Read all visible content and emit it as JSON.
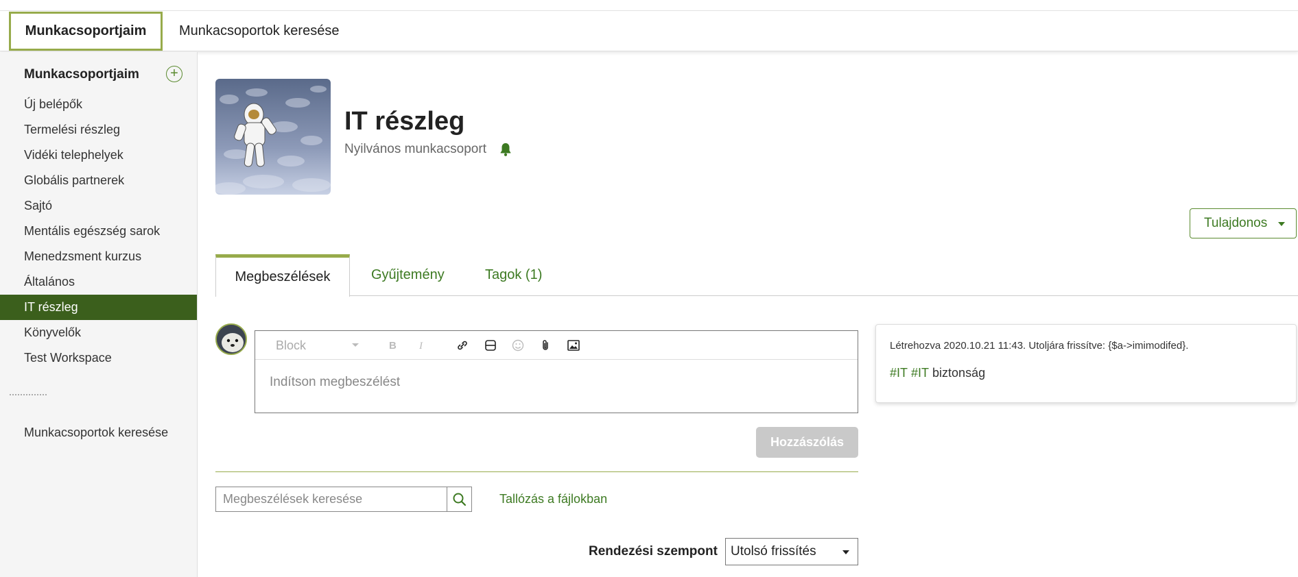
{
  "top_tabs": [
    {
      "label": "Munkacsoportjaim",
      "active": true
    },
    {
      "label": "Munkacsoportok keresése",
      "active": false
    }
  ],
  "sidebar": {
    "title": "Munkacsoportjaim",
    "add_label": "+",
    "items": [
      {
        "label": "Új belépők"
      },
      {
        "label": "Termelési részleg"
      },
      {
        "label": "Vidéki telephelyek"
      },
      {
        "label": "Globális partnerek"
      },
      {
        "label": "Sajtó"
      },
      {
        "label": "Mentális egészség sarok"
      },
      {
        "label": "Menedzsment kurzus"
      },
      {
        "label": "Általános"
      },
      {
        "label": "IT részleg",
        "active": true
      },
      {
        "label": "Könyvelők"
      },
      {
        "label": "Test Workspace"
      }
    ],
    "search_link": "Munkacsoportok keresése"
  },
  "workspace": {
    "title": "IT részleg",
    "subtitle": "Nyilvános munkacsoport",
    "role_button": "Tulajdonos"
  },
  "content_tabs": [
    {
      "label": "Megbeszélések",
      "active": true
    },
    {
      "label": "Gyűjtemény"
    },
    {
      "label": "Tagok (1)"
    }
  ],
  "editor": {
    "block_label": "Block",
    "placeholder": "Indítson megbeszélést",
    "submit_label": "Hozzászólás"
  },
  "search": {
    "placeholder": "Megbeszélések keresése",
    "browse_link": "Tallózás a fájlokban"
  },
  "sort": {
    "label": "Rendezési szempont",
    "value": "Utolsó frissítés"
  },
  "info": {
    "meta": "Létrehozva 2020.10.21 11:43. Utoljára frissítve: {$a->imimodifed}.",
    "tags": [
      "#IT",
      "#IT"
    ],
    "plain_tag": "biztonság"
  },
  "colors": {
    "accent_green": "#3d7a22",
    "active_sidebar": "#3b5f1c",
    "tab_border": "#97ab4b"
  }
}
